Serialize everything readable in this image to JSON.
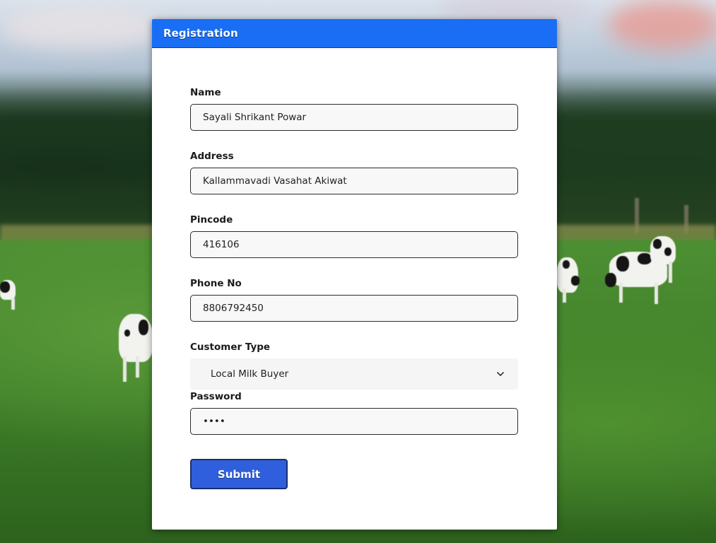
{
  "form": {
    "title": "Registration",
    "name": {
      "label": "Name",
      "value": "Sayali Shrikant Powar"
    },
    "address": {
      "label": "Address",
      "value": "Kallammavadi Vasahat Akiwat"
    },
    "pincode": {
      "label": "Pincode",
      "value": "416106"
    },
    "phone": {
      "label": "Phone No",
      "value": "8806792450"
    },
    "customer_type": {
      "label": "Customer Type",
      "value": "Local Milk Buyer",
      "icon": "chevron-down-icon"
    },
    "password": {
      "label": "Password",
      "value": "••••"
    },
    "submit_label": "Submit"
  },
  "colors": {
    "header_bg": "#1a6ef5",
    "button_bg": "#2f5fdd",
    "button_border": "#1b2f6e"
  }
}
